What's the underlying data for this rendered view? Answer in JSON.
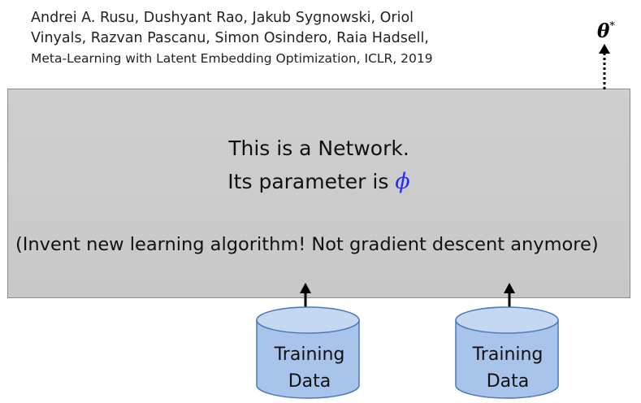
{
  "citation": {
    "authors_line1": "Andrei A. Rusu, Dushyant Rao, Jakub Sygnowski, Oriol",
    "authors_line2": "Vinyals, Razvan Pascanu, Simon Osindero, Raia Hadsell,",
    "paper": "Meta-Learning with Latent Embedding Optimization, ICLR, 2019"
  },
  "output": {
    "symbol": "θ",
    "superscript": "*"
  },
  "network": {
    "line1": "This is a Network.",
    "line2_prefix": "Its parameter is ",
    "param_symbol": "ϕ",
    "note": "(Invent new learning algorithm! Not gradient descent anymore)"
  },
  "inputs": [
    {
      "line1": "Training",
      "line2": "Data"
    },
    {
      "line1": "Training",
      "line2": "Data"
    }
  ],
  "colors": {
    "box_fill": "#cccccc",
    "cylinder_fill": "#a9c4ea",
    "cylinder_stroke": "#4a78b8",
    "param_color": "#2b2bff"
  }
}
